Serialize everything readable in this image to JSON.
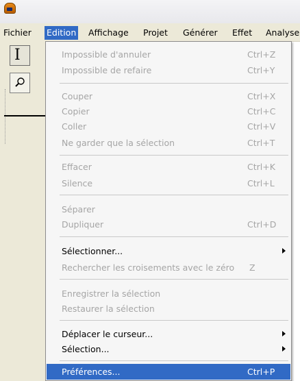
{
  "menubar": {
    "items": [
      {
        "label": "Fichier"
      },
      {
        "label": "Edition"
      },
      {
        "label": "Affichage"
      },
      {
        "label": "Projet"
      },
      {
        "label": "Générer"
      },
      {
        "label": "Effet"
      },
      {
        "label": "Analyse"
      }
    ],
    "active": "Edition"
  },
  "edit_menu": {
    "undo": {
      "label": "Impossible d'annuler",
      "shortcut": "Ctrl+Z",
      "enabled": false
    },
    "redo": {
      "label": "Impossible de refaire",
      "shortcut": "Ctrl+Y",
      "enabled": false
    },
    "cut": {
      "label": "Couper",
      "shortcut": "Ctrl+X",
      "enabled": false
    },
    "copy": {
      "label": "Copier",
      "shortcut": "Ctrl+C",
      "enabled": false
    },
    "paste": {
      "label": "Coller",
      "shortcut": "Ctrl+V",
      "enabled": false
    },
    "trim": {
      "label": "Ne garder que la sélection",
      "shortcut": "Ctrl+T",
      "enabled": false
    },
    "delete": {
      "label": "Effacer",
      "shortcut": "Ctrl+K",
      "enabled": false
    },
    "silence": {
      "label": "Silence",
      "shortcut": "Ctrl+L",
      "enabled": false
    },
    "split": {
      "label": "Séparer",
      "shortcut": "",
      "enabled": false
    },
    "duplicate": {
      "label": "Dupliquer",
      "shortcut": "Ctrl+D",
      "enabled": false
    },
    "select": {
      "label": "Sélectionner...",
      "enabled": true,
      "submenu": true
    },
    "find_zero": {
      "label": "Rechercher les croisements avec le zéro",
      "shortcut": "Z",
      "enabled": false
    },
    "save_selection": {
      "label": "Enregistrer la sélection",
      "enabled": false
    },
    "restore_selection": {
      "label": "Restaurer la sélection",
      "enabled": false
    },
    "move_cursor": {
      "label": "Déplacer le curseur...",
      "enabled": true,
      "submenu": true
    },
    "selection": {
      "label": "Sélection...",
      "enabled": true,
      "submenu": true
    },
    "preferences": {
      "label": "Préférences...",
      "shortcut": "Ctrl+P",
      "enabled": true,
      "highlighted": true
    }
  },
  "colors": {
    "highlight": "#316ac5",
    "disabled_text": "#a5a5a5",
    "menubar_bg": "#ece9d8",
    "menu_bg": "#f6f6f6"
  },
  "icons": [
    "audacity-app-icon",
    "selection-tool-icon",
    "zoom-tool-icon",
    "submenu-arrow-icon"
  ]
}
